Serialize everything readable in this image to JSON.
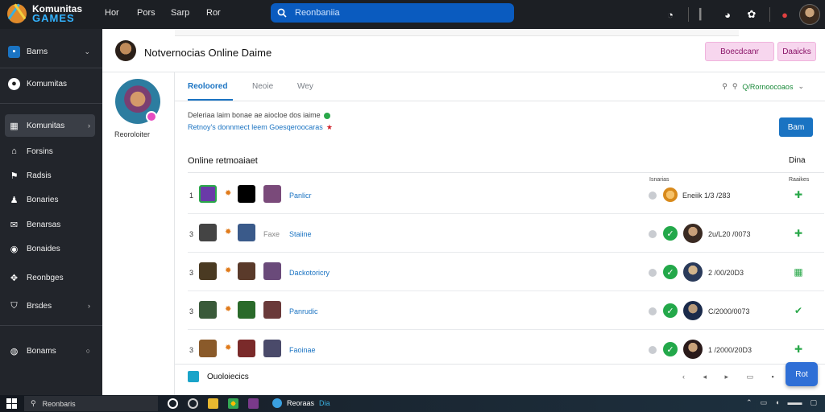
{
  "app": {
    "logo_line1": "Komunitas",
    "logo_line2": "GAMES"
  },
  "topnav": {
    "items": [
      "Hor",
      "Pors",
      "Sarp",
      "Ror"
    ]
  },
  "search": {
    "text": "Reonbaniia"
  },
  "sidebar": {
    "items": [
      {
        "label": "Barns",
        "icon": "square-app-icon"
      },
      {
        "label": "Komumitas",
        "icon": "community-icon"
      },
      {
        "label": "Komunitas",
        "icon": "grid-icon"
      },
      {
        "label": "Forsins",
        "icon": "home-icon"
      },
      {
        "label": "Radsis",
        "icon": "flag-icon"
      },
      {
        "label": "Bonaries",
        "icon": "person-icon"
      },
      {
        "label": "Benarsas",
        "icon": "mail-icon"
      },
      {
        "label": "Bonaides",
        "icon": "chat-icon"
      },
      {
        "label": "Reonbges",
        "icon": "gamepad-icon"
      },
      {
        "label": "Brsdes",
        "icon": "shield-icon"
      },
      {
        "label": "Bonams",
        "icon": "globe-icon"
      }
    ]
  },
  "header": {
    "title": "Notvernocias Online Daime",
    "btn1": "Boecdcanr",
    "btn2": "Daaicks"
  },
  "profile": {
    "name": "Reoroloiter"
  },
  "tabs": {
    "items": [
      "Reoloored",
      "Neoie",
      "Wey"
    ],
    "right_label": "Q/Rornoocoaos"
  },
  "info": {
    "line1": "Deleriaa laim bonae  ae aiocloe dos iaime",
    "line2": "Retnoy's donnmect leem  Goesqeroocaras",
    "button": "Bam"
  },
  "section": {
    "title": "Online retmoaiaet",
    "right": "Dina",
    "col_status": "Isnarias",
    "col_action": "Raaikes"
  },
  "rows": [
    {
      "num": "1",
      "label": "Panlicr",
      "sub": "",
      "date": "Eneiik 1/3 /283",
      "status_icon": "coin-icon"
    },
    {
      "num": "3",
      "label": "Staiine",
      "sub": "Faxe",
      "date": "2u/L20 /0073",
      "status_icon": "check-icon"
    },
    {
      "num": "3",
      "label": "Dackotoricry",
      "sub": "",
      "date": "2 /00/20D3",
      "status_icon": "check-icon"
    },
    {
      "num": "3",
      "label": "Panrudic",
      "sub": "",
      "date": "C/2000/0073",
      "status_icon": "check-icon"
    },
    {
      "num": "3",
      "label": "Faoinae",
      "sub": "",
      "date": "1 /2000/20D3",
      "status_icon": "check-icon"
    }
  ],
  "bottom": {
    "label": "Ouoloiecics",
    "float_button": "Rot"
  },
  "taskbar": {
    "search_text": "Reonbaris",
    "active_app": "Reoraas",
    "active_app2": "Dia"
  },
  "colors": {
    "accent": "#1a73c2",
    "sidebar_bg": "#22252b",
    "success": "#23a84a",
    "pink": "#f7d6ee"
  }
}
